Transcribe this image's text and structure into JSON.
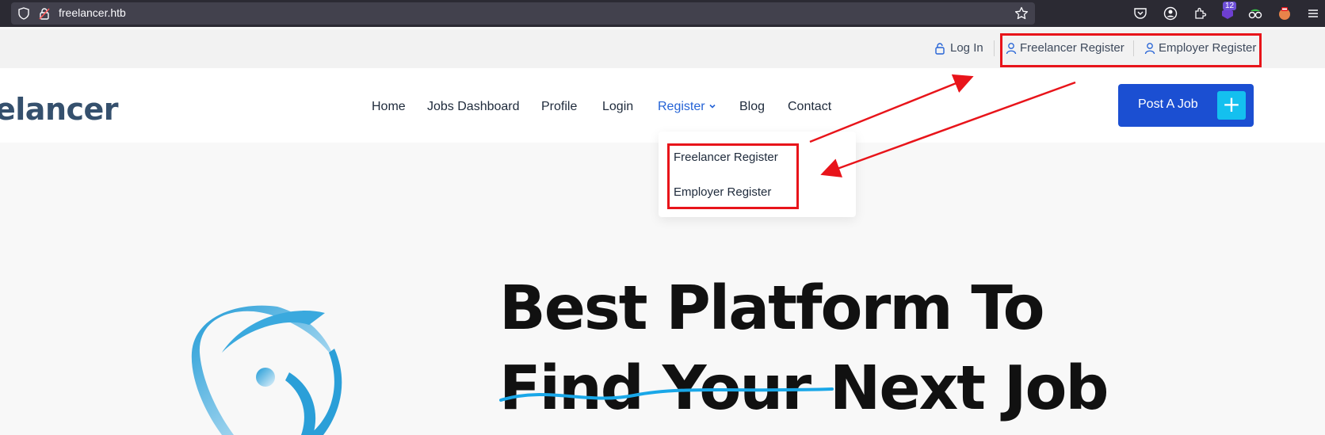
{
  "browser": {
    "url": "freelancer.htb",
    "extension_badge": "12"
  },
  "topbar": {
    "login": "Log In",
    "freelancer_register": "Freelancer Register",
    "employer_register": "Employer Register"
  },
  "header": {
    "logo_text": "elancer",
    "nav": [
      "Home",
      "Jobs Dashboard",
      "Profile",
      "Login",
      "Register",
      "Blog",
      "Contact"
    ],
    "post_job": "Post A Job",
    "post_job_icon": "+"
  },
  "dropdown": {
    "items": [
      "Freelancer Register",
      "Employer Register"
    ]
  },
  "hero": {
    "line1": "Best Platform To",
    "line2": "Find Your Next Job"
  },
  "colors": {
    "accent": "#1b4fd2",
    "plus_bg": "#14c0ef",
    "annotation": "#e8141a",
    "nav_active": "#2563d6"
  }
}
